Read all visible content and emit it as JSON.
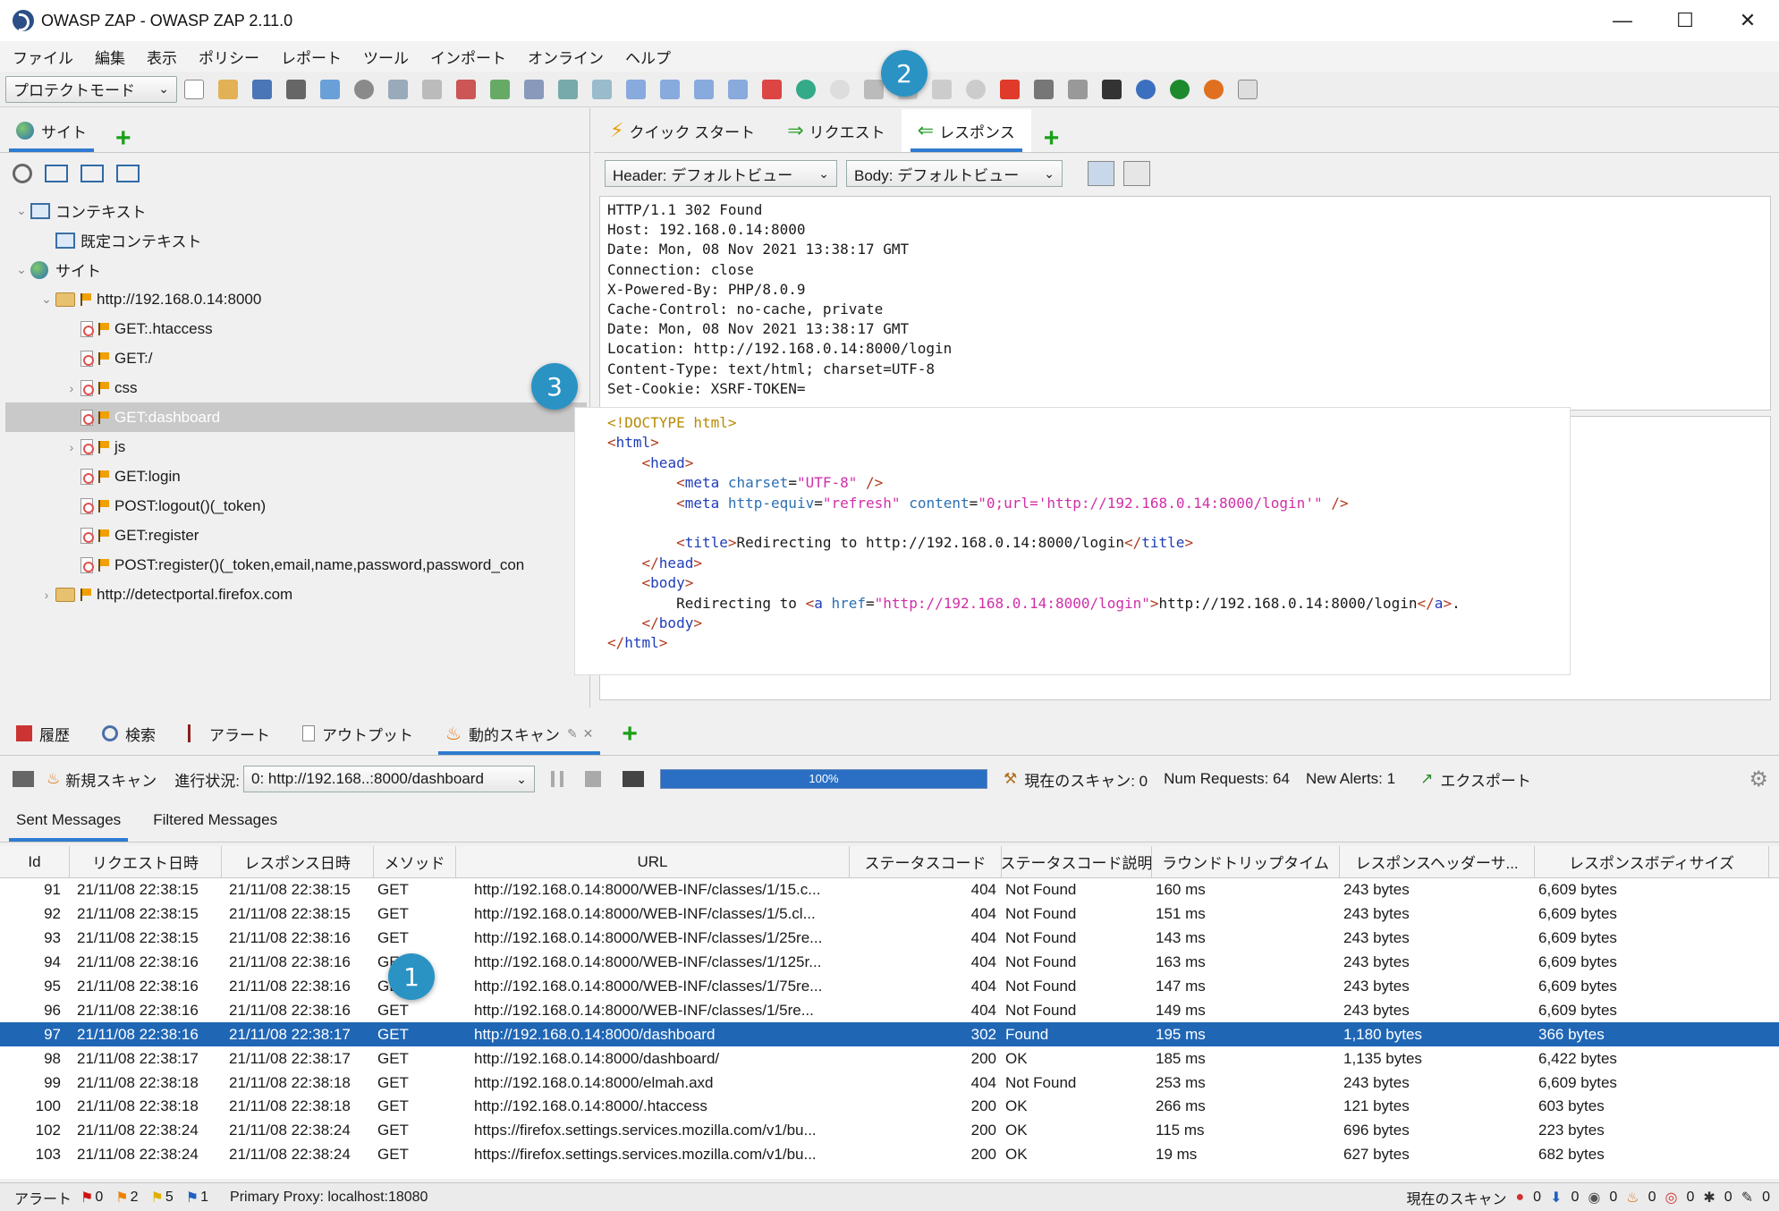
{
  "window": {
    "title": "OWASP ZAP - OWASP ZAP 2.11.0",
    "minimize": "—",
    "maximize": "☐",
    "close": "✕"
  },
  "menu": [
    "ファイル",
    "編集",
    "表示",
    "ポリシー",
    "レポート",
    "ツール",
    "インポート",
    "オンライン",
    "ヘルプ"
  ],
  "toolbar": {
    "mode": "プロテクトモード"
  },
  "left": {
    "tab_sites": "サイト",
    "tree": [
      {
        "label": "コンテキスト",
        "type": "context-root",
        "indent": 0,
        "arrow": "⌄"
      },
      {
        "label": "既定コンテキスト",
        "type": "context",
        "indent": 1,
        "arrow": ""
      },
      {
        "label": "サイト",
        "type": "globe",
        "indent": 0,
        "arrow": "⌄"
      },
      {
        "label": "http://192.168.0.14:8000",
        "type": "folder",
        "indent": 1,
        "arrow": "⌄"
      },
      {
        "label": "GET:.htaccess",
        "type": "page",
        "indent": 2,
        "arrow": ""
      },
      {
        "label": "GET:/",
        "type": "page",
        "indent": 2,
        "arrow": ""
      },
      {
        "label": "css",
        "type": "pagefolder",
        "indent": 2,
        "arrow": "›"
      },
      {
        "label": "GET:dashboard",
        "type": "page",
        "indent": 2,
        "arrow": "",
        "selected": true
      },
      {
        "label": "js",
        "type": "pagefolder",
        "indent": 2,
        "arrow": "›"
      },
      {
        "label": "GET:login",
        "type": "page",
        "indent": 2,
        "arrow": ""
      },
      {
        "label": "POST:logout()(_token)",
        "type": "page",
        "indent": 2,
        "arrow": ""
      },
      {
        "label": "GET:register",
        "type": "page",
        "indent": 2,
        "arrow": ""
      },
      {
        "label": "POST:register()(_token,email,name,password,password_con",
        "type": "page",
        "indent": 2,
        "arrow": ""
      },
      {
        "label": "http://detectportal.firefox.com",
        "type": "folder",
        "indent": 1,
        "arrow": "›"
      }
    ]
  },
  "right": {
    "tab_quickstart": "クイック スタート",
    "tab_request": "リクエスト",
    "tab_response": "レスポンス",
    "header_view": "Header: デフォルトビュー",
    "body_view": "Body: デフォルトビュー",
    "headers": [
      "HTTP/1.1 302 Found",
      "Host: 192.168.0.14:8000",
      "Date: Mon, 08 Nov 2021 13:38:17 GMT",
      "Connection: close",
      "X-Powered-By: PHP/8.0.9",
      "Cache-Control: no-cache, private",
      "Date: Mon, 08 Nov 2021 13:38:17 GMT",
      "Location: http://192.168.0.14:8000/login",
      "Content-Type: text/html; charset=UTF-8",
      "Set-Cookie: XSRF-TOKEN="
    ],
    "body": {
      "doctype": "<!DOCTYPE html>",
      "url": "http://192.168.0.14:8000/login",
      "meta_charset": "\"UTF-8\"",
      "meta_refresh": "\"refresh\"",
      "meta_content": "\"0;url='http://192.168.0.14:8000/login'\"",
      "title_text": "Redirecting to http://192.168.0.14:8000/login",
      "body_text": "Redirecting to ",
      "href": "\"http://192.168.0.14:8000/login\"",
      "link_text": "http://192.168.0.14:8000/login"
    }
  },
  "bottom": {
    "tab_history": "履歴",
    "tab_search": "検索",
    "tab_alerts": "アラート",
    "tab_output": "アウトプット",
    "tab_ascan": "動的スキャン",
    "new_scan": "新規スキャン",
    "progress_label": "進行状況:",
    "progress_select": "0: http://192.168..:8000/dashboard",
    "progress_value": 1.0,
    "progress_text": "100%",
    "current_scans": "現在のスキャン: 0",
    "num_requests": "Num Requests: 64",
    "new_alerts": "New Alerts: 1",
    "export": "エクスポート",
    "subtab_sent": "Sent Messages",
    "subtab_filtered": "Filtered Messages"
  },
  "table": {
    "columns": [
      "Id",
      "リクエスト日時",
      "レスポンス日時",
      "メソッド",
      "URL",
      "ステータスコード",
      "ステータスコード説明",
      "ラウンドトリップタイム",
      "レスポンスヘッダーサ...",
      "レスポンスボディサイズ"
    ],
    "rows": [
      [
        "91",
        "21/11/08 22:38:15",
        "21/11/08 22:38:15",
        "GET",
        "http://192.168.0.14:8000/WEB-INF/classes/1/15.c...",
        "404",
        "Not Found",
        "160 ms",
        "243 bytes",
        "6,609 bytes"
      ],
      [
        "92",
        "21/11/08 22:38:15",
        "21/11/08 22:38:15",
        "GET",
        "http://192.168.0.14:8000/WEB-INF/classes/1/5.cl...",
        "404",
        "Not Found",
        "151 ms",
        "243 bytes",
        "6,609 bytes"
      ],
      [
        "93",
        "21/11/08 22:38:15",
        "21/11/08 22:38:16",
        "GET",
        "http://192.168.0.14:8000/WEB-INF/classes/1/25re...",
        "404",
        "Not Found",
        "143 ms",
        "243 bytes",
        "6,609 bytes"
      ],
      [
        "94",
        "21/11/08 22:38:16",
        "21/11/08 22:38:16",
        "GET",
        "http://192.168.0.14:8000/WEB-INF/classes/1/125r...",
        "404",
        "Not Found",
        "163 ms",
        "243 bytes",
        "6,609 bytes"
      ],
      [
        "95",
        "21/11/08 22:38:16",
        "21/11/08 22:38:16",
        "GET",
        "http://192.168.0.14:8000/WEB-INF/classes/1/75re...",
        "404",
        "Not Found",
        "147 ms",
        "243 bytes",
        "6,609 bytes"
      ],
      [
        "96",
        "21/11/08 22:38:16",
        "21/11/08 22:38:16",
        "GET",
        "http://192.168.0.14:8000/WEB-INF/classes/1/5re...",
        "404",
        "Not Found",
        "149 ms",
        "243 bytes",
        "6,609 bytes"
      ],
      [
        "97",
        "21/11/08 22:38:16",
        "21/11/08 22:38:17",
        "GET",
        "http://192.168.0.14:8000/dashboard",
        "302",
        "Found",
        "195 ms",
        "1,180 bytes",
        "366 bytes"
      ],
      [
        "98",
        "21/11/08 22:38:17",
        "21/11/08 22:38:17",
        "GET",
        "http://192.168.0.14:8000/dashboard/",
        "200",
        "OK",
        "185 ms",
        "1,135 bytes",
        "6,422 bytes"
      ],
      [
        "99",
        "21/11/08 22:38:18",
        "21/11/08 22:38:18",
        "GET",
        "http://192.168.0.14:8000/elmah.axd",
        "404",
        "Not Found",
        "253 ms",
        "243 bytes",
        "6,609 bytes"
      ],
      [
        "100",
        "21/11/08 22:38:18",
        "21/11/08 22:38:18",
        "GET",
        "http://192.168.0.14:8000/.htaccess",
        "200",
        "OK",
        "266 ms",
        "121 bytes",
        "603 bytes"
      ],
      [
        "102",
        "21/11/08 22:38:24",
        "21/11/08 22:38:24",
        "GET",
        "https://firefox.settings.services.mozilla.com/v1/bu...",
        "200",
        "OK",
        "115 ms",
        "696 bytes",
        "223 bytes"
      ],
      [
        "103",
        "21/11/08 22:38:24",
        "21/11/08 22:38:24",
        "GET",
        "https://firefox.settings.services.mozilla.com/v1/bu...",
        "200",
        "OK",
        "19 ms",
        "627 bytes",
        "682 bytes"
      ]
    ],
    "selected_index": 6
  },
  "status": {
    "alerts_label": "アラート",
    "alert_high": "0",
    "alert_medium": "2",
    "alert_low": "5",
    "alert_info": "1",
    "proxy": "Primary Proxy: localhost:18080",
    "current_scans_label": "現在のスキャン",
    "counts": [
      "0",
      "0",
      "0",
      "0",
      "0",
      "0",
      "0"
    ]
  },
  "callouts": [
    "1",
    "2",
    "3"
  ]
}
